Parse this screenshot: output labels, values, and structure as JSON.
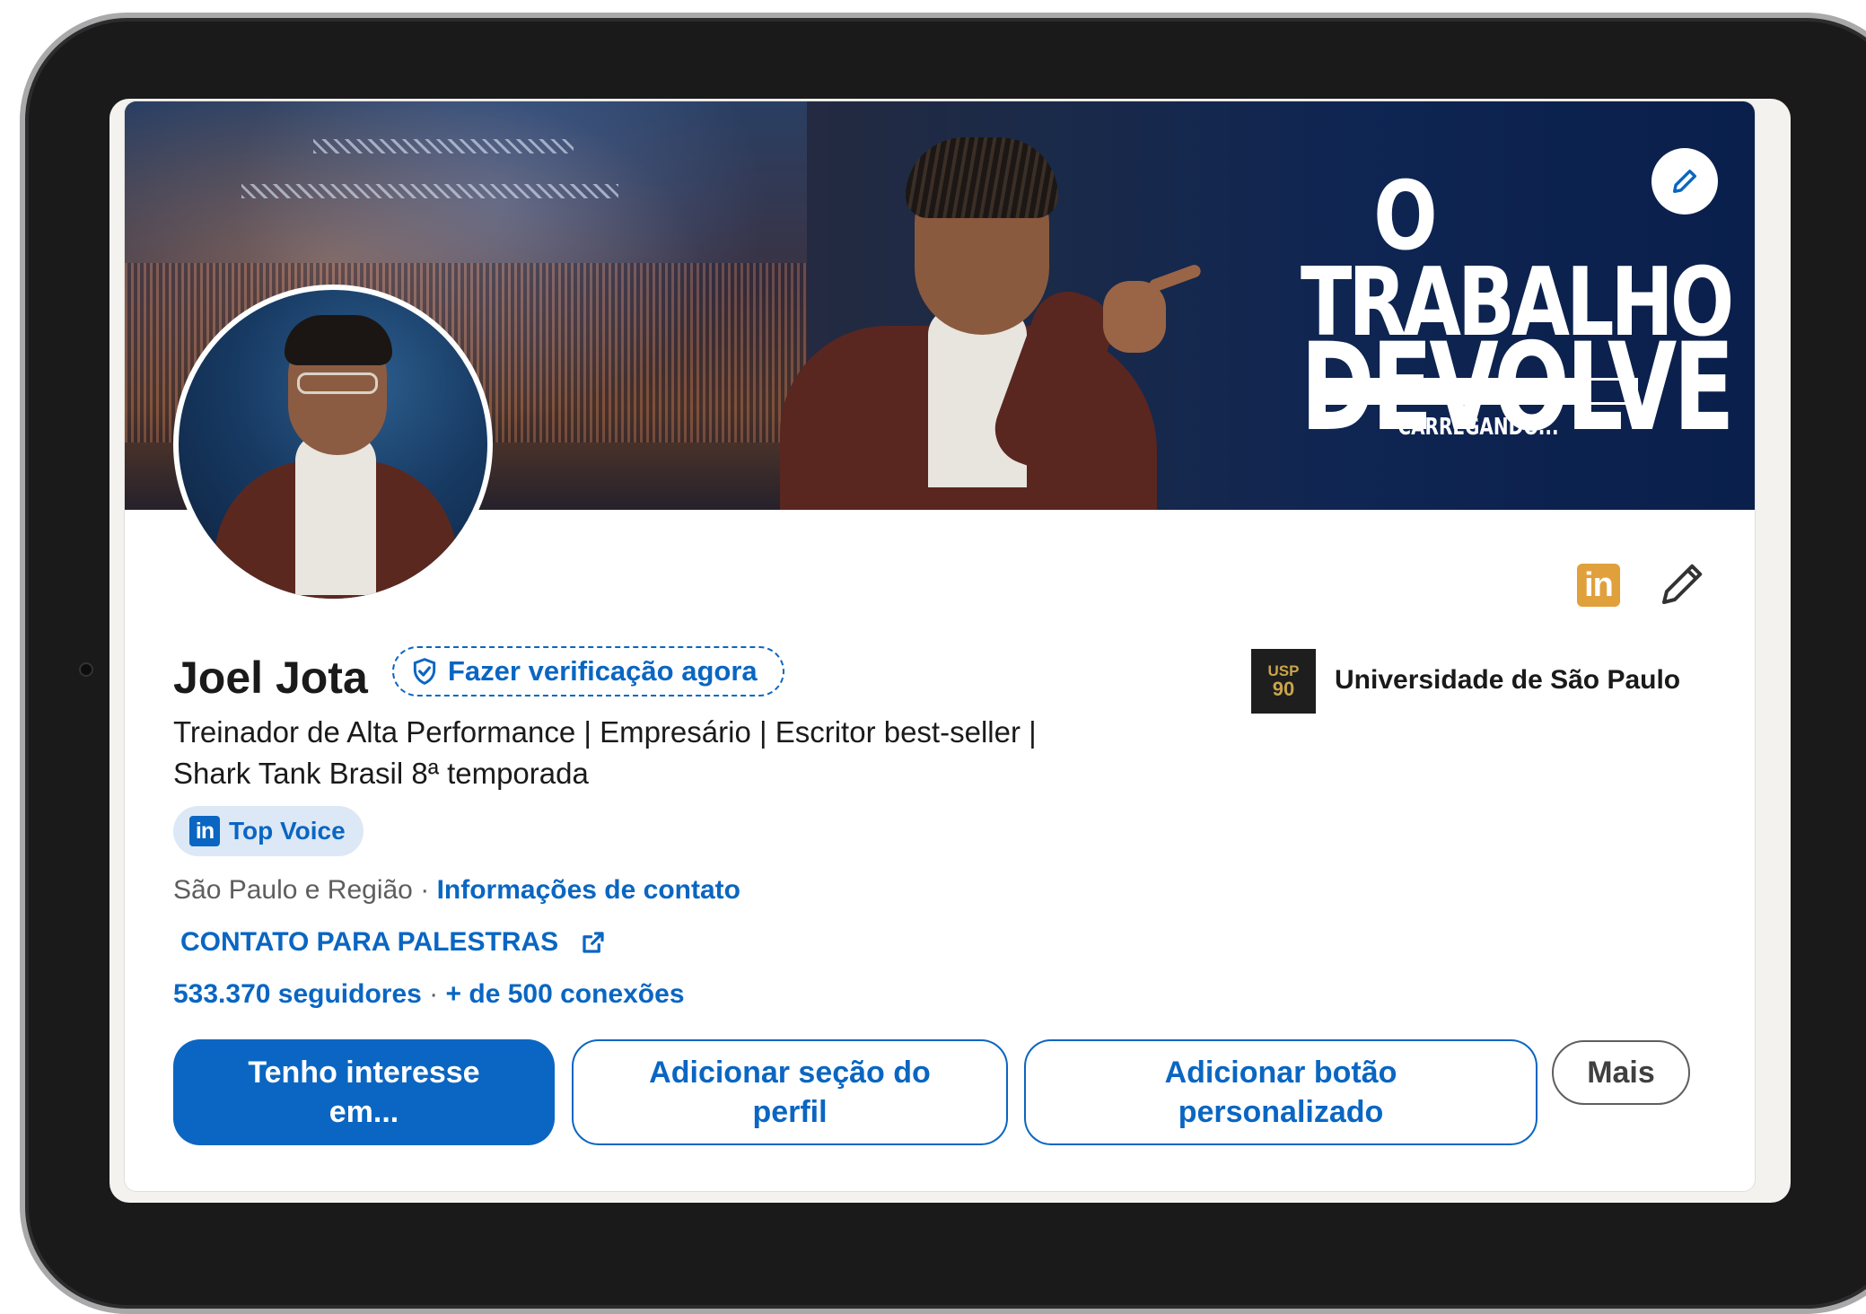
{
  "banner": {
    "title_line1": "O TRABALHO",
    "title_line2": "DEVOLVE",
    "loading_text": "CARREGANDO...",
    "loading_progress": 0.82
  },
  "profile": {
    "name": "Joel Jota",
    "verify_label": "Fazer verificação agora",
    "headline_line1": "Treinador de Alta Performance | Empresário | Escritor best-seller |",
    "headline_line2": "Shark Tank Brasil 8ª temporada",
    "top_voice_icon_text": "in",
    "top_voice_label": "Top Voice",
    "location": "São Paulo e Região",
    "location_separator": "·",
    "contact_info_link": "Informações de contato",
    "custom_link": "CONTATO PARA PALESTRAS",
    "followers": "533.370 seguidores",
    "stats_separator": "·",
    "connections": "+ de 500 conexões"
  },
  "education": {
    "logo_text_top": "USP",
    "logo_text_bottom": "90",
    "name": "Universidade de São Paulo"
  },
  "linkedin_icon_text": "in",
  "actions": {
    "primary_label": "Tenho interesse em...",
    "add_section_label": "Adicionar seção do perfil",
    "custom_button_label": "Adicionar botão personalizado",
    "more_label": "Mais"
  },
  "colors": {
    "accent": "#0a66c2",
    "linkedin_badge": "#e0a03c",
    "banner_navy": "#0a1f4b"
  }
}
